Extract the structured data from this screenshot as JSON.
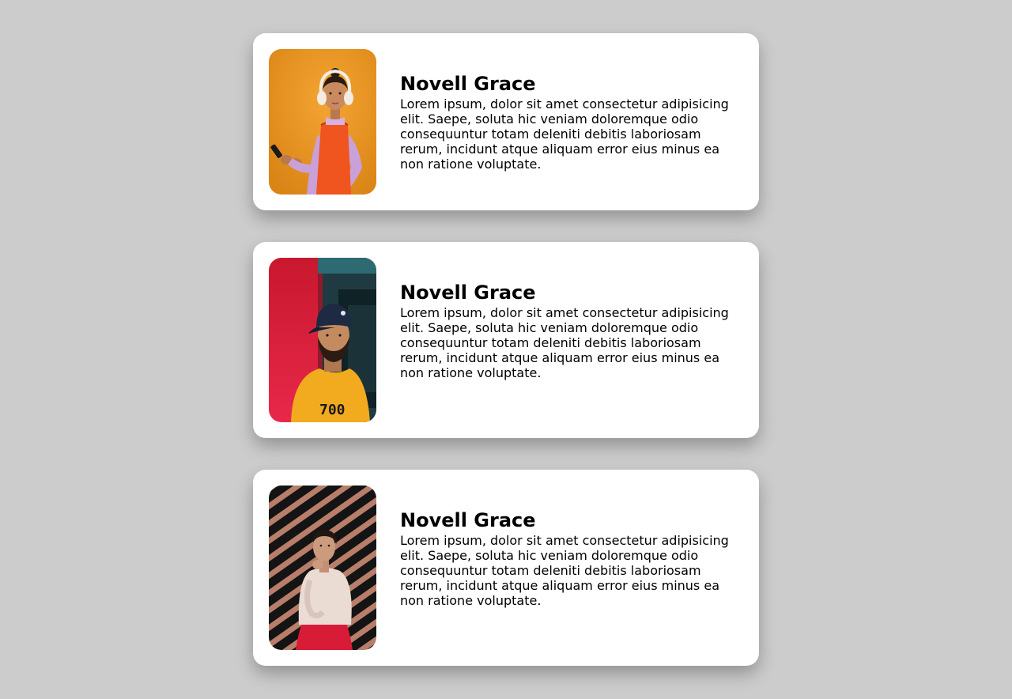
{
  "colors": {
    "page_background": "#cccccc",
    "card_background": "#ffffff",
    "text": "#000000"
  },
  "cards": [
    {
      "name": "Novell Grace",
      "bio": "Lorem ipsum, dolor sit amet consectetur adipisicing elit. Saepe, soluta hic veniam doloremque odio consequuntur totam deleniti debitis laboriosam rerum, incidunt atque aliquam error eius minus ea non ratione voluptate.",
      "photo_icon": "woman-with-headphones-photo"
    },
    {
      "name": "Novell Grace",
      "bio": "Lorem ipsum, dolor sit amet consectetur adipisicing elit. Saepe, soluta hic veniam doloremque odio consequuntur totam deleniti debitis laboriosam rerum, incidunt atque aliquam error eius minus ea non ratione voluptate.",
      "photo_icon": "man-with-cap-photo"
    },
    {
      "name": "Novell Grace",
      "bio": "Lorem ipsum, dolor sit amet consectetur adipisicing elit. Saepe, soluta hic veniam doloremque odio consequuntur totam deleniti debitis laboriosam rerum, incidunt atque aliquam error eius minus ea non ratione voluptate.",
      "photo_icon": "woman-striped-wall-photo"
    }
  ]
}
